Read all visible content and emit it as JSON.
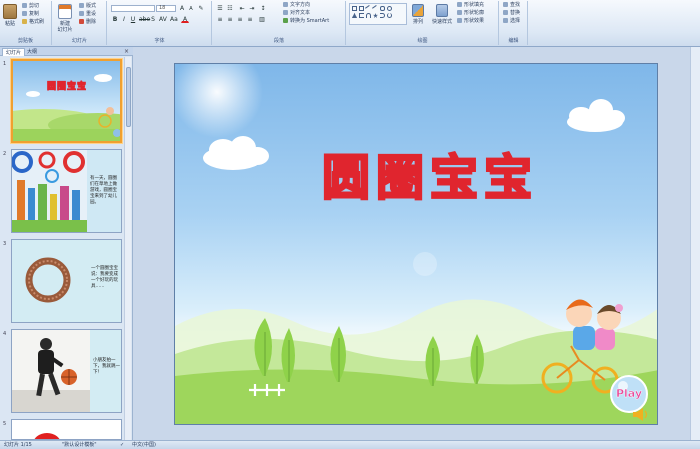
{
  "ribbon": {
    "clipboard": {
      "group": "剪贴板",
      "paste": "粘贴",
      "cut": "剪切",
      "copy": "复制",
      "format_painter": "格式刷"
    },
    "slides": {
      "group": "幻灯片",
      "new_slide": "新建",
      "new_slide2": "幻灯片",
      "layout": "版式",
      "reset": "重设",
      "delete": "删除"
    },
    "font": {
      "group": "字体",
      "size": "18"
    },
    "paragraph": {
      "group": "段落",
      "text_direction": "文字方向",
      "align_text": "对齐文本",
      "smartart": "转换为 SmartArt"
    },
    "drawing": {
      "group": "绘图",
      "arrange": "排列",
      "quick_styles": "快速样式",
      "shape_fill": "形状填充",
      "shape_outline": "形状轮廓",
      "shape_effects": "形状效果"
    },
    "editing": {
      "group": "编辑",
      "find": "查找",
      "replace": "替换",
      "select": "选择"
    }
  },
  "pane": {
    "tab_slides": "幻灯片",
    "tab_outline": "大纲",
    "close": "×",
    "slides": [
      {
        "num": "1",
        "title": "圆圈宝宝"
      },
      {
        "num": "2",
        "text": "有一天，圆圈们在草地上做游戏，圆圈宝宝来到了幼儿园。"
      },
      {
        "num": "3",
        "text": "一个圆圈宝宝说：我要变成一个好玩的玩具……"
      },
      {
        "num": "4",
        "text": "小朋友拍一下，我就跳一下！"
      },
      {
        "num": "5"
      }
    ]
  },
  "slide": {
    "title": "圆圈宝宝",
    "play": "Play"
  },
  "status": {
    "slide_info": "幻灯片 1/15",
    "theme": "\"默认设计模板\"",
    "language": "中文(中国)"
  },
  "colors": {
    "title_red": "#e0252e",
    "selected_thumb": "#f0a030",
    "ribbon_bg": "#dde8f5"
  }
}
